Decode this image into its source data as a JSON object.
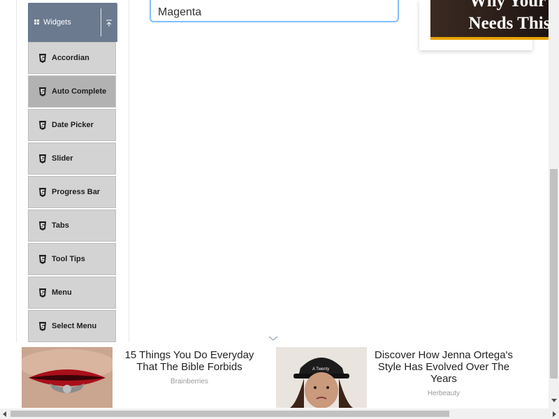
{
  "sidebar": {
    "group_title": "Widgets",
    "items": [
      {
        "label": "Accordian",
        "active": false
      },
      {
        "label": "Auto Complete",
        "active": true
      },
      {
        "label": "Date Picker",
        "active": false
      },
      {
        "label": "Slider",
        "active": false
      },
      {
        "label": "Progress Bar",
        "active": false
      },
      {
        "label": "Tabs",
        "active": false
      },
      {
        "label": "Tool Tips",
        "active": false
      },
      {
        "label": "Menu",
        "active": false
      },
      {
        "label": "Select Menu",
        "active": false
      }
    ]
  },
  "main": {
    "color_input_value": "Magenta"
  },
  "top_ad": {
    "headline_line1": "Why Your F",
    "headline_line2": "Needs This I"
  },
  "bottom_ads": [
    {
      "headline": "15 Things You Do Everyday That The Bible Forbids",
      "source": "Brainberries"
    },
    {
      "headline": "Discover How Jenna Ortega's Style Has Evolved Over The Years",
      "source": "Herbeauty"
    }
  ],
  "icons": {
    "group": "widgets-grid-icon",
    "collapse": "collapse-up-icon",
    "item": "html5-icon",
    "ad_toggle": "chevron-down-icon"
  },
  "colors": {
    "group_header_bg": "#6b7a8f",
    "item_bg": "#d3d3d3",
    "item_active_bg": "#b2b2b2",
    "input_focus_border": "#80bdff"
  }
}
